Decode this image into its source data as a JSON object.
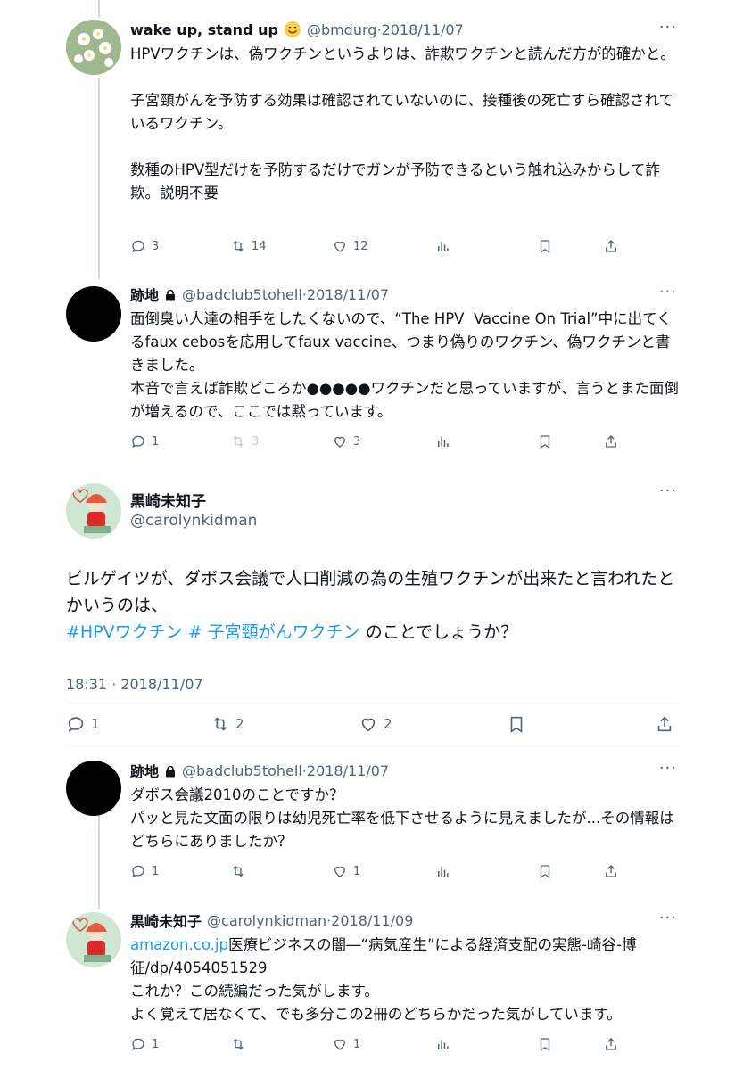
{
  "tweets": [
    {
      "name": "wake up, stand up",
      "handle": "@bmdurg",
      "sep": "·",
      "date": "2018/11/07",
      "body": "HPVワクチンは、偽ワクチンというよりは、詐欺ワクチンと読んだ方が的確かと。\n\n子宮頸がんを予防する効果は確認されていないのに、接種後の死亡すら確認されているワクチン。\n\n数種のHPV型だけを予防するだけでガンが予防できるという触れ込みからして詐欺。説明不要",
      "replies": "3",
      "retweets": "14",
      "likes": "12"
    },
    {
      "name": "跡地",
      "handle": "@badclub5tohell",
      "sep": "·",
      "date": "2018/11/07",
      "body": "面倒臭い人達の相手をしたくないので、“The HPV  Vaccine On Trial”中に出てくるfaux cebosを応用してfaux vaccine、つまり偽りのワクチン、偽ワクチンと書きました。\n本音で言えば詐欺どころか●●●●●ワクチンだと思っていますが、言うとまた面倒が増えるので、ここでは黙っています。",
      "replies": "1",
      "retweets": "3",
      "likes": "3"
    },
    {
      "name": "跡地",
      "handle": "@badclub5tohell",
      "sep": "·",
      "date": "2018/11/07",
      "body": "ダボス会議2010のことですか？\nパッと見た文面の限りは幼児死亡率を低下させるように見えましたが...その情報はどちらにありましたか？",
      "replies": "1",
      "retweets": "",
      "likes": "1"
    },
    {
      "name": "黒崎未知子",
      "handle": "@carolynkidman",
      "sep": "·",
      "date": "2018/11/09",
      "link": "amazon.co.jp",
      "body": "医療ビジネスの闇―“病気産生”による経済支配の実態-崎谷-博征/dp/4054051529\nこれか？この続編だった気がします。\nよく覚えて居なくて、でも多分この2冊のどちらかだった気がしています。",
      "replies": "1",
      "retweets": "",
      "likes": "1"
    }
  ],
  "main": {
    "name": "黒崎未知子",
    "handle": "@carolynkidman",
    "body_text": "ビルゲイツが、ダボス会議で人口削減の為の生殖ワクチンが出来たと言われたとかいうのは、",
    "hashtag1": "#HPVワクチン",
    "hashtag2": "# 子宮頸がんワクチン",
    "body_tail": " のことでしょうか？",
    "time": "18:31 · 2018/11/07",
    "replies": "1",
    "retweets": "2",
    "likes": "2"
  },
  "more_glyph": "···",
  "colors": {
    "accent": "#1d9bf0",
    "secondary_text": "#536471",
    "thread_line": "#cfd9de"
  },
  "icons": [
    "reply-icon",
    "retweet-icon",
    "like-icon",
    "views-icon",
    "bookmark-icon",
    "share-icon",
    "lock-icon",
    "smile-emoji-icon"
  ]
}
